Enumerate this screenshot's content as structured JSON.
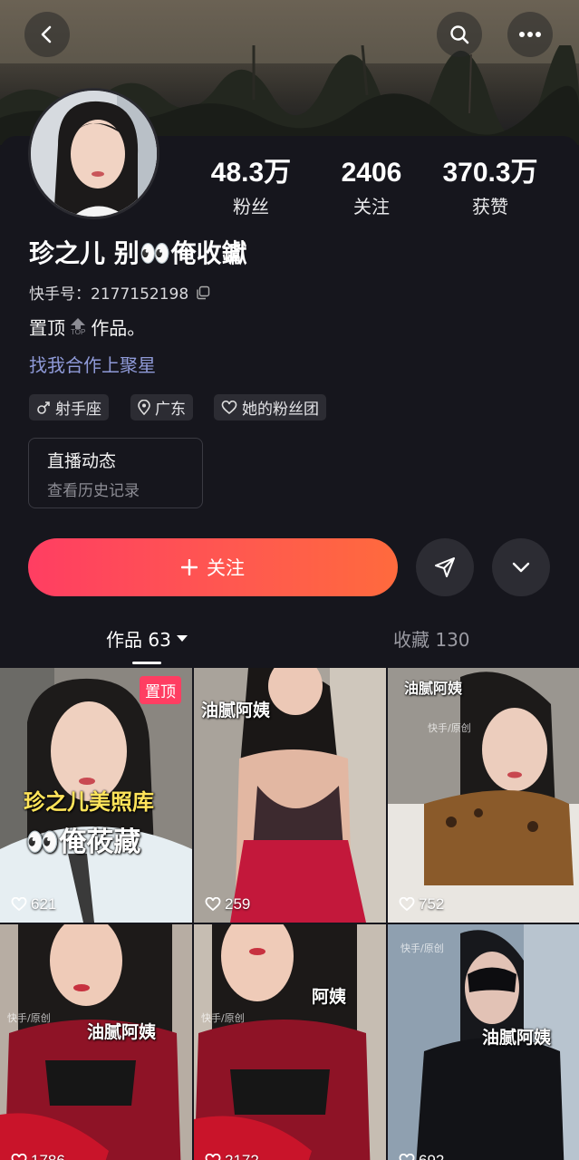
{
  "profile": {
    "name": "珍之儿 别👀俺收钀",
    "kuaishou_id": "快手号：2177152198",
    "bio_prefix": "置顶",
    "bio_suffix": "作品。",
    "bio_top_badge": "TOP",
    "business_link": "找我合作上聚星"
  },
  "stats": [
    {
      "value": "48.3万",
      "label": "粉丝"
    },
    {
      "value": "2406",
      "label": "关注"
    },
    {
      "value": "370.3万",
      "label": "获赞"
    }
  ],
  "tags": [
    {
      "icon": "male-symbol-icon",
      "label": "射手座"
    },
    {
      "icon": "location-pin-icon",
      "label": "广东"
    },
    {
      "icon": "heart-outline-icon",
      "label": "她的粉丝团"
    }
  ],
  "live_card": {
    "title": "直播动态",
    "subtitle": "查看历史记录"
  },
  "actions": {
    "follow_label": "关注"
  },
  "tabs": [
    {
      "label": "作品 63",
      "active": true
    },
    {
      "label": "收藏 130",
      "active": false
    }
  ],
  "posts": [
    {
      "likes": "621",
      "pinned_label": "置顶",
      "caption_1": "珍之儿美照库",
      "caption_2": "👀俺莜藏"
    },
    {
      "likes": "259",
      "caption_1": "油腻阿姨"
    },
    {
      "likes": "752",
      "caption_1": "油腻阿姨",
      "watermark": "快手/原创"
    },
    {
      "likes": "1786",
      "caption_1": "油腻阿姨",
      "watermark": "快手/原创"
    },
    {
      "likes": "2172",
      "caption_1": "阿姨",
      "watermark": "快手/原创"
    },
    {
      "likes": "692",
      "caption_1": "油腻阿姨",
      "watermark": "快手/原创"
    }
  ],
  "colors": {
    "background": "#16161d",
    "follow_button": "#ff4a5a",
    "link": "#8f9ad8",
    "pin_badge": "#ff3e62"
  }
}
